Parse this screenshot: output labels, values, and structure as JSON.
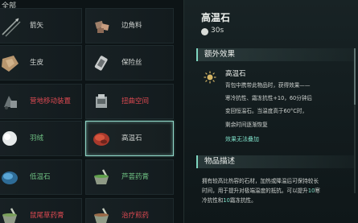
{
  "inventory": {
    "category_tab": "全部",
    "items": [
      {
        "label": "箭矢",
        "color": "norm"
      },
      {
        "label": "边角料",
        "color": "norm"
      },
      {
        "label": "生皮",
        "color": "norm"
      },
      {
        "label": "保险丝",
        "color": "norm"
      },
      {
        "label": "营地移动装置",
        "color": "red"
      },
      {
        "label": "扭曲空间",
        "color": "red"
      },
      {
        "label": "羽绒",
        "color": "green"
      },
      {
        "label": "高温石",
        "color": "norm",
        "selected": true
      },
      {
        "label": "低温石",
        "color": "green"
      },
      {
        "label": "芦荟药膏",
        "color": "green"
      },
      {
        "label": "鼠尾草药膏",
        "color": "red"
      },
      {
        "label": "治疗煎药",
        "color": "red"
      }
    ]
  },
  "detail": {
    "title": "高温石",
    "time": "30s",
    "effects_heading": "额外效果",
    "effect_name": "高温石",
    "effect_lines": [
      [
        "背包中携带此物品时，获得效果——",
        ""
      ],
      [
        "寒冷抗性、霜冻抗性+10，60分钟后",
        ""
      ],
      [
        "变回恒温石。当温度高于60°C时，",
        ""
      ],
      [
        "剩余时间逐渐恢复",
        ""
      ]
    ],
    "effect_warning": "效果无法叠加",
    "description_heading": "物品描述",
    "description_lines": [
      {
        "pre": "拥有较高比热容的石材，加热或降温后可保持较长",
        "hl": "",
        "post": ""
      },
      {
        "pre": "时间，用于提升对极端温度的抵抗。可以提升",
        "hl": "10",
        "post": "寒"
      },
      {
        "pre": "冷抗性和",
        "hl": "10",
        "post": "霜冻抗性。"
      }
    ]
  },
  "colors": {
    "accent": "#7fe0c9",
    "red_label": "#e04a52",
    "green_label": "#6fc183",
    "selected_border": "#8fd6c6"
  }
}
